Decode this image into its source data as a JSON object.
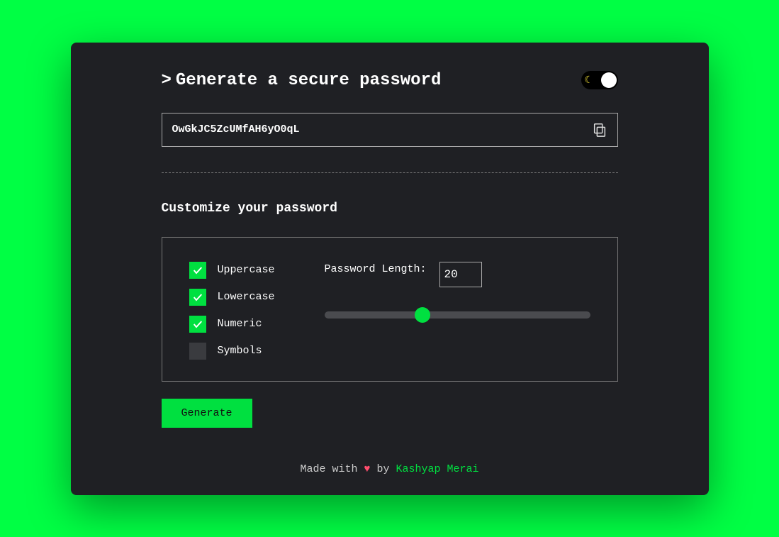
{
  "header": {
    "prompt": ">",
    "title": "Generate a secure password"
  },
  "output": {
    "password": "OwGkJC5ZcUMfAH6yO0qL"
  },
  "customize": {
    "title": "Customize your password",
    "options": {
      "uppercase": {
        "label": "Uppercase",
        "checked": true
      },
      "lowercase": {
        "label": "Lowercase",
        "checked": true
      },
      "numeric": {
        "label": "Numeric",
        "checked": true
      },
      "symbols": {
        "label": "Symbols",
        "checked": false
      }
    },
    "length": {
      "label": "Password Length:",
      "value": "20"
    }
  },
  "generate_label": "Generate",
  "footer": {
    "prefix": "Made with ",
    "heart": "♥",
    "by": " by ",
    "author": "Kashyap Merai"
  }
}
